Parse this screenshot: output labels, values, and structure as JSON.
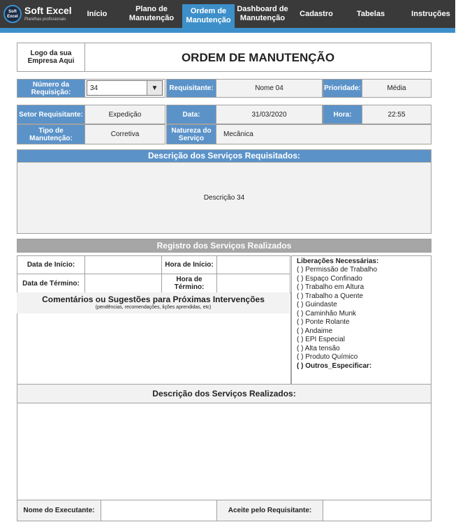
{
  "nav": {
    "logo_mark": "Soft Excel",
    "logo_title": "Soft Excel",
    "logo_subtitle": "Planilhas profissionais",
    "items": [
      {
        "label": "Início"
      },
      {
        "label": "Plano de Manutenção"
      },
      {
        "label": "Ordem de Manutenção"
      },
      {
        "label": "Dashboard de Manutenção"
      },
      {
        "label": "Cadastro"
      },
      {
        "label": "Tabelas"
      },
      {
        "label": "Instruções"
      }
    ],
    "active_index": 2
  },
  "colors": {
    "nav_bg": "#3a3a3a",
    "accent": "#3d8fc9",
    "label_blue": "#5b93c9",
    "section_grey": "#a6a6a6"
  },
  "form": {
    "logo_placeholder": "Logo da sua Empresa Aqui",
    "title": "ORDEM DE MANUTENÇÃO",
    "row1": {
      "numero_label": "Número da Requisição:",
      "numero_value": "34",
      "requisitante_label": "Requisitante:",
      "requisitante_value": "Nome 04",
      "prioridade_label": "Prioridade:",
      "prioridade_value": "Média"
    },
    "row2": {
      "setor_label": "Setor Requisitante:",
      "setor_value": "Expedição",
      "data_label": "Data:",
      "data_value": "31/03/2020",
      "hora_label": "Hora:",
      "hora_value": "22:55"
    },
    "row3": {
      "tipo_label": "Tipo de Manutenção:",
      "tipo_value": "Corretiva",
      "natureza_label": "Natureza do Serviço",
      "natureza_value": "Mecânica"
    },
    "descricao_requisitados_header": "Descrição dos Serviços Requisitados:",
    "descricao_requisitados_value": "Descrição 34",
    "registro_header": "Registro dos Serviços Realizados",
    "data_inicio_label": "Data de Início:",
    "hora_inicio_label": "Hora de Início:",
    "data_termino_label": "Data de Término:",
    "hora_termino_label": "Hora de Término:",
    "comentarios_title": "Comentários ou Sugestões para Próximas Intervenções",
    "comentarios_subtitle": "(pendências, recomendações, lições aprendidas, etc)",
    "liberacoes_title": "Liberações Necessárias:",
    "liberacoes": [
      "(   ) Permissão de Trabalho",
      "(   ) Espaço Confinado",
      "(   ) Trabalho em Altura",
      "(   ) Trabalho a Quente",
      "(   ) Guindaste",
      "(   ) Caminhão Munk",
      "(   ) Ponte Rolante",
      "(   ) Andaime",
      "(   ) EPI Especial",
      "(   ) Alta tensão",
      "(   ) Produto Químico"
    ],
    "liberacoes_last": "(   ) Outros_Especificar:",
    "descricao_realizados_header": "Descrição dos Serviços Realizados:",
    "executante_label": "Nome do Executante:",
    "aceite_label": "Aceite pelo Requisitante:"
  }
}
